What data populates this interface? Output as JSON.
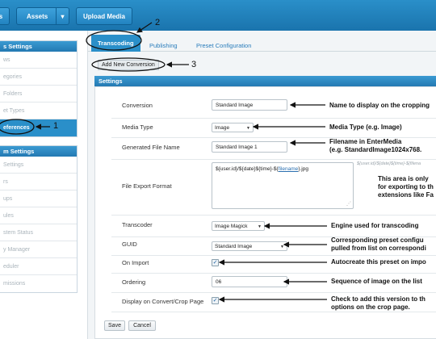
{
  "topbar": {
    "btn_left": "s",
    "assets_label": "Assets",
    "assets_caret": "▾",
    "upload_label": "Upload Media"
  },
  "sidebar": {
    "section1_title": "s Settings",
    "section1_items": [
      "ws",
      "egories",
      "Folders",
      "et Types",
      "eferences"
    ],
    "section2_title": "m Settings",
    "section2_items": [
      " Settings",
      "rs",
      "ups",
      "ules",
      "stem Status",
      "y Manager",
      "eduler",
      "missions"
    ]
  },
  "tabs": [
    "Transcoding",
    "Publishing",
    "Preset Configuration"
  ],
  "add_conversion": "Add New Conversion",
  "settings_title": "Settings",
  "fields": {
    "conversion": {
      "label": "Conversion",
      "value": "Standard Image"
    },
    "media_type": {
      "label": "Media Type",
      "value": "Image"
    },
    "generated_file_name": {
      "label": "Generated File Name",
      "value": "Standard Image 1"
    },
    "file_export_format": {
      "label": "File Export Format",
      "value_plain": "${user.id}/${date}${time}-${",
      "value_link": "filename",
      "value_tail": "}.jpg",
      "hint": "${user.id}/${date}${time}-${filena"
    },
    "transcoder": {
      "label": "Transcoder",
      "value": "Image Magick"
    },
    "guid": {
      "label": "GUID",
      "value": "Standard Image"
    },
    "on_import": {
      "label": "On Import",
      "checked": "✓"
    },
    "ordering": {
      "label": "Ordering",
      "value": "06"
    },
    "display_on_crop": {
      "label": "Display on Convert/Crop Page",
      "checked": "✓"
    }
  },
  "buttons": {
    "save": "Save",
    "cancel": "Cancel"
  },
  "annotations": {
    "num1": "1",
    "num2": "2",
    "num3": "3",
    "conversion_note": "Name to display on the cropping",
    "media_type_note": "Media Type (e.g. Image)",
    "filename_note_1": "Filename in EnterMedia",
    "filename_note_2": "(e.g. StandardImage1024x768.",
    "export_note_1": "This area is only",
    "export_note_2": "for exporting to th",
    "export_note_3": "extensions like Fa",
    "transcoder_note": "Engine used for transcoding",
    "guid_note_1": "Corresponding preset configu",
    "guid_note_2": "pulled from list on correspondi",
    "on_import_note": "Autocreate this preset on impo",
    "ordering_note": "Sequence of image on the list",
    "display_note_1": "Check to add this version to th",
    "display_note_2": "options on the crop page."
  },
  "colors": {
    "brand_blue": "#2a8fc9",
    "header_blue": "#2379b2"
  }
}
